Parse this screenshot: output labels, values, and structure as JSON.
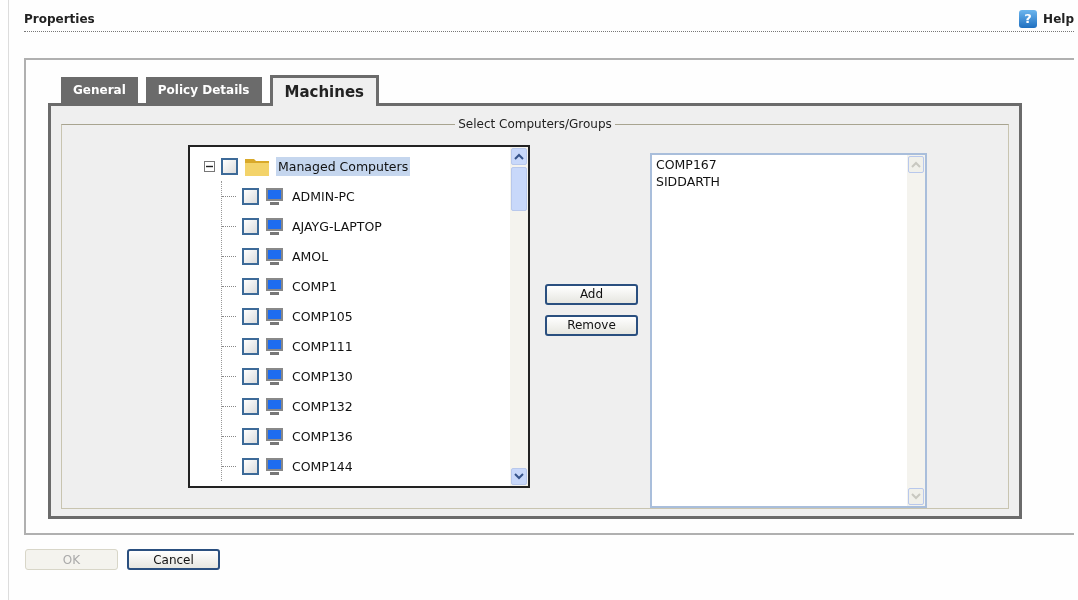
{
  "header": {
    "title": "Properties",
    "help_icon_glyph": "?",
    "help": "Help"
  },
  "tabs": [
    {
      "label": "General",
      "selected": false
    },
    {
      "label": "Policy Details",
      "selected": false
    },
    {
      "label": "Machines",
      "selected": true
    }
  ],
  "group": {
    "legend": "Select Computers/Groups"
  },
  "tree": {
    "label": "Managed Computers",
    "expanded": true,
    "checked": false,
    "selected": true,
    "children": [
      {
        "label": "ADMIN-PC",
        "checked": false
      },
      {
        "label": "AJAYG-LAPTOP",
        "checked": false
      },
      {
        "label": "AMOL",
        "checked": false
      },
      {
        "label": "COMP1",
        "checked": false
      },
      {
        "label": "COMP105",
        "checked": false
      },
      {
        "label": "COMP111",
        "checked": false
      },
      {
        "label": "COMP130",
        "checked": false
      },
      {
        "label": "COMP132",
        "checked": false
      },
      {
        "label": "COMP136",
        "checked": false
      },
      {
        "label": "COMP144",
        "checked": false
      }
    ]
  },
  "move_buttons": [
    "Add",
    "Remove"
  ],
  "selected_list": [
    "COMP167",
    "SIDDARTH"
  ],
  "footer": [
    {
      "label": "OK",
      "disabled": true
    },
    {
      "label": "Cancel",
      "disabled": false
    }
  ]
}
